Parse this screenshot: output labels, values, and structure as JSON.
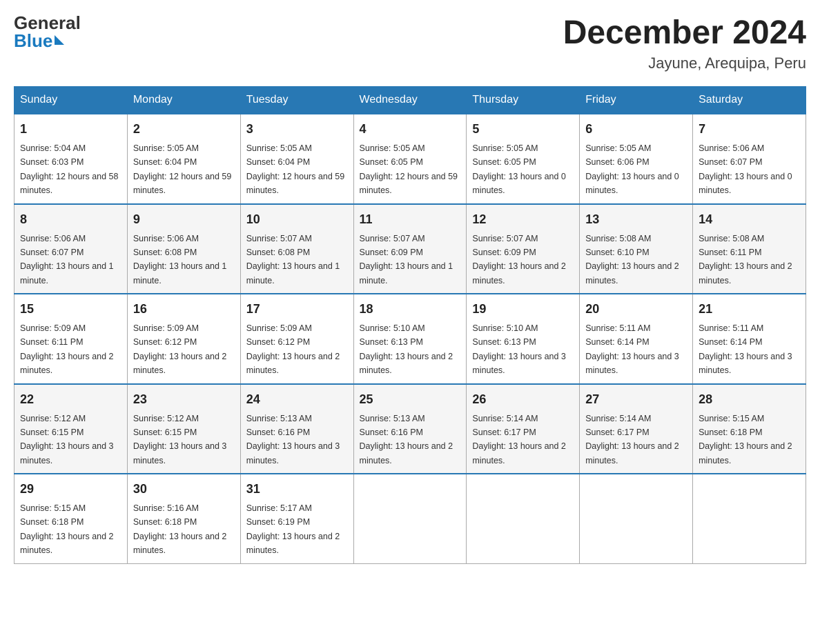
{
  "header": {
    "logo_general": "General",
    "logo_blue": "Blue",
    "title": "December 2024",
    "subtitle": "Jayune, Arequipa, Peru"
  },
  "days_of_week": [
    "Sunday",
    "Monday",
    "Tuesday",
    "Wednesday",
    "Thursday",
    "Friday",
    "Saturday"
  ],
  "weeks": [
    [
      {
        "num": "1",
        "sunrise": "5:04 AM",
        "sunset": "6:03 PM",
        "daylight": "12 hours and 58 minutes."
      },
      {
        "num": "2",
        "sunrise": "5:05 AM",
        "sunset": "6:04 PM",
        "daylight": "12 hours and 59 minutes."
      },
      {
        "num": "3",
        "sunrise": "5:05 AM",
        "sunset": "6:04 PM",
        "daylight": "12 hours and 59 minutes."
      },
      {
        "num": "4",
        "sunrise": "5:05 AM",
        "sunset": "6:05 PM",
        "daylight": "12 hours and 59 minutes."
      },
      {
        "num": "5",
        "sunrise": "5:05 AM",
        "sunset": "6:05 PM",
        "daylight": "13 hours and 0 minutes."
      },
      {
        "num": "6",
        "sunrise": "5:05 AM",
        "sunset": "6:06 PM",
        "daylight": "13 hours and 0 minutes."
      },
      {
        "num": "7",
        "sunrise": "5:06 AM",
        "sunset": "6:07 PM",
        "daylight": "13 hours and 0 minutes."
      }
    ],
    [
      {
        "num": "8",
        "sunrise": "5:06 AM",
        "sunset": "6:07 PM",
        "daylight": "13 hours and 1 minute."
      },
      {
        "num": "9",
        "sunrise": "5:06 AM",
        "sunset": "6:08 PM",
        "daylight": "13 hours and 1 minute."
      },
      {
        "num": "10",
        "sunrise": "5:07 AM",
        "sunset": "6:08 PM",
        "daylight": "13 hours and 1 minute."
      },
      {
        "num": "11",
        "sunrise": "5:07 AM",
        "sunset": "6:09 PM",
        "daylight": "13 hours and 1 minute."
      },
      {
        "num": "12",
        "sunrise": "5:07 AM",
        "sunset": "6:09 PM",
        "daylight": "13 hours and 2 minutes."
      },
      {
        "num": "13",
        "sunrise": "5:08 AM",
        "sunset": "6:10 PM",
        "daylight": "13 hours and 2 minutes."
      },
      {
        "num": "14",
        "sunrise": "5:08 AM",
        "sunset": "6:11 PM",
        "daylight": "13 hours and 2 minutes."
      }
    ],
    [
      {
        "num": "15",
        "sunrise": "5:09 AM",
        "sunset": "6:11 PM",
        "daylight": "13 hours and 2 minutes."
      },
      {
        "num": "16",
        "sunrise": "5:09 AM",
        "sunset": "6:12 PM",
        "daylight": "13 hours and 2 minutes."
      },
      {
        "num": "17",
        "sunrise": "5:09 AM",
        "sunset": "6:12 PM",
        "daylight": "13 hours and 2 minutes."
      },
      {
        "num": "18",
        "sunrise": "5:10 AM",
        "sunset": "6:13 PM",
        "daylight": "13 hours and 2 minutes."
      },
      {
        "num": "19",
        "sunrise": "5:10 AM",
        "sunset": "6:13 PM",
        "daylight": "13 hours and 3 minutes."
      },
      {
        "num": "20",
        "sunrise": "5:11 AM",
        "sunset": "6:14 PM",
        "daylight": "13 hours and 3 minutes."
      },
      {
        "num": "21",
        "sunrise": "5:11 AM",
        "sunset": "6:14 PM",
        "daylight": "13 hours and 3 minutes."
      }
    ],
    [
      {
        "num": "22",
        "sunrise": "5:12 AM",
        "sunset": "6:15 PM",
        "daylight": "13 hours and 3 minutes."
      },
      {
        "num": "23",
        "sunrise": "5:12 AM",
        "sunset": "6:15 PM",
        "daylight": "13 hours and 3 minutes."
      },
      {
        "num": "24",
        "sunrise": "5:13 AM",
        "sunset": "6:16 PM",
        "daylight": "13 hours and 3 minutes."
      },
      {
        "num": "25",
        "sunrise": "5:13 AM",
        "sunset": "6:16 PM",
        "daylight": "13 hours and 2 minutes."
      },
      {
        "num": "26",
        "sunrise": "5:14 AM",
        "sunset": "6:17 PM",
        "daylight": "13 hours and 2 minutes."
      },
      {
        "num": "27",
        "sunrise": "5:14 AM",
        "sunset": "6:17 PM",
        "daylight": "13 hours and 2 minutes."
      },
      {
        "num": "28",
        "sunrise": "5:15 AM",
        "sunset": "6:18 PM",
        "daylight": "13 hours and 2 minutes."
      }
    ],
    [
      {
        "num": "29",
        "sunrise": "5:15 AM",
        "sunset": "6:18 PM",
        "daylight": "13 hours and 2 minutes."
      },
      {
        "num": "30",
        "sunrise": "5:16 AM",
        "sunset": "6:18 PM",
        "daylight": "13 hours and 2 minutes."
      },
      {
        "num": "31",
        "sunrise": "5:17 AM",
        "sunset": "6:19 PM",
        "daylight": "13 hours and 2 minutes."
      },
      null,
      null,
      null,
      null
    ]
  ],
  "labels": {
    "sunrise": "Sunrise:",
    "sunset": "Sunset:",
    "daylight": "Daylight:"
  }
}
